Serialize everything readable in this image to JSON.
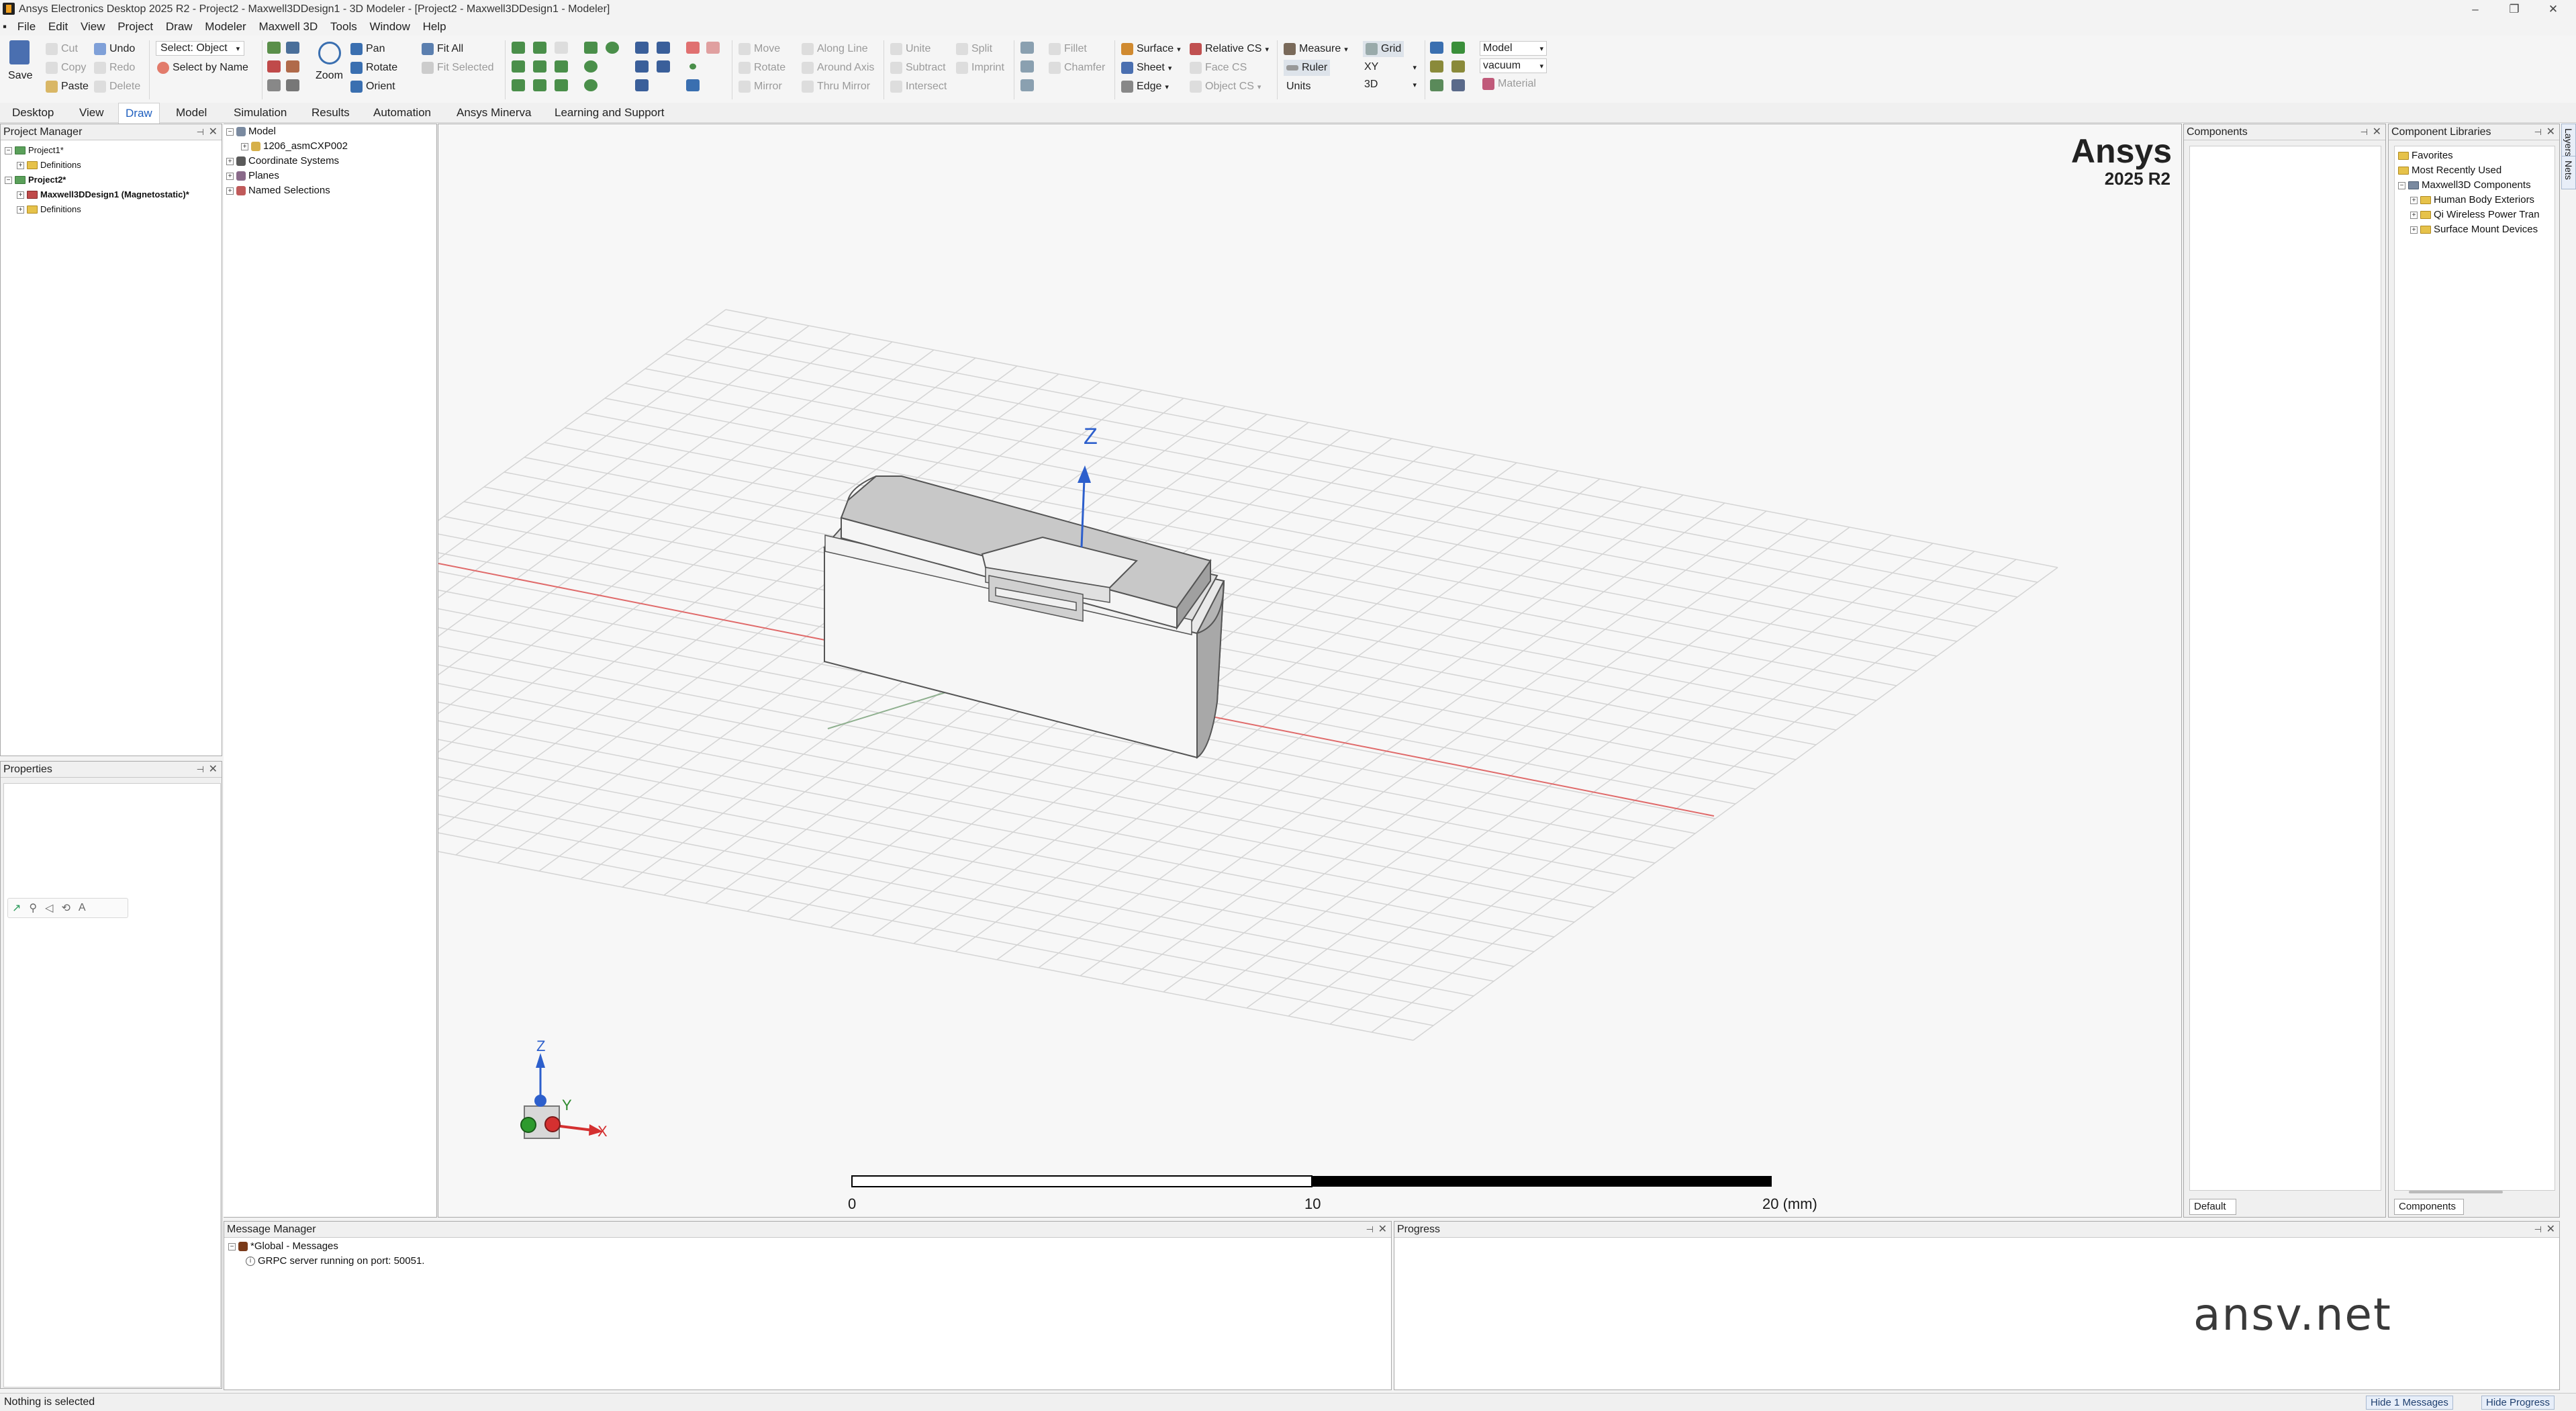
{
  "window": {
    "title": "Ansys Electronics Desktop 2025 R2 - Project2 - Maxwell3DDesign1 - 3D Modeler - [Project2 - Maxwell3DDesign1 - Modeler]"
  },
  "menu": [
    "File",
    "Edit",
    "View",
    "Project",
    "Draw",
    "Modeler",
    "Maxwell 3D",
    "Tools",
    "Window",
    "Help"
  ],
  "ribbon": {
    "save": "Save",
    "cut": "Cut",
    "copy": "Copy",
    "paste": "Paste",
    "undo": "Undo",
    "redo": "Redo",
    "delete": "Delete",
    "select_object": "Select: Object",
    "select_by_name": "Select by Name",
    "zoom": "Zoom",
    "pan": "Pan",
    "rotate": "Rotate",
    "orient": "Orient",
    "fit_all": "Fit All",
    "fit_selected": "Fit Selected",
    "move": "Move",
    "rotate2": "Rotate",
    "mirror": "Mirror",
    "along_line": "Along Line",
    "around_axis": "Around Axis",
    "thru_mirror": "Thru Mirror",
    "unite": "Unite",
    "subtract": "Subtract",
    "intersect": "Intersect",
    "split": "Split",
    "imprint": "Imprint",
    "fillet": "Fillet",
    "chamfer": "Chamfer",
    "surface": "Surface",
    "sheet": "Sheet",
    "edge": "Edge",
    "relative_cs": "Relative CS",
    "face_cs": "Face CS",
    "object_cs": "Object CS",
    "measure": "Measure",
    "ruler": "Ruler",
    "units": "Units",
    "grid": "Grid",
    "plane_value": "XY",
    "dim_value": "3D",
    "model_value": "Model",
    "material_value": "vacuum",
    "material": "Material"
  },
  "tabs": [
    "Desktop",
    "View",
    "Draw",
    "Model",
    "Simulation",
    "Results",
    "Automation",
    "Ansys Minerva",
    "Learning and Support"
  ],
  "active_tab": "Draw",
  "project_manager": {
    "title": "Project Manager",
    "items": [
      {
        "label": "Project1*"
      },
      {
        "label": "Definitions"
      },
      {
        "label": "Project2*"
      },
      {
        "label": "Maxwell3DDesign1 (Magnetostatic)*"
      },
      {
        "label": "Definitions"
      }
    ]
  },
  "properties": {
    "title": "Properties"
  },
  "model_tree": {
    "items": [
      {
        "label": "Model"
      },
      {
        "label": "1206_asmCXP002"
      },
      {
        "label": "Coordinate Systems"
      },
      {
        "label": "Planes"
      },
      {
        "label": "Named Selections"
      }
    ]
  },
  "viewport": {
    "brand": "Ansys",
    "version": "2025 R2",
    "z_label": "Z",
    "triad": {
      "z": "Z",
      "y": "Y",
      "x": "X"
    },
    "scale": {
      "t0": "0",
      "t1": "10",
      "t2": "20 (mm)"
    }
  },
  "components": {
    "title": "Components",
    "footer_tab": "Default"
  },
  "component_libraries": {
    "title": "Component Libraries",
    "items": [
      {
        "label": "Favorites"
      },
      {
        "label": "Most Recently Used"
      },
      {
        "label": "Maxwell3D Components"
      },
      {
        "label": "Human Body Exteriors"
      },
      {
        "label": "Qi Wireless Power Tran"
      },
      {
        "label": "Surface Mount Devices"
      }
    ],
    "footer_tab": "Components",
    "side_tabs": [
      "Layers",
      "Nets"
    ]
  },
  "message_manager": {
    "title": "Message Manager",
    "global": "*Global - Messages",
    "message": "GRPC server running on port: 50051."
  },
  "progress": {
    "title": "Progress"
  },
  "watermark": "ansv.net",
  "status": {
    "text": "Nothing is selected",
    "hide_messages": "Hide 1 Messages",
    "hide_progress": "Hide Progress"
  },
  "colors": {
    "accent": "#1f5fbf",
    "axis_z": "#2d5fcc",
    "x_axis_red": "#d44040",
    "y_axis_green": "#3a8f3a"
  }
}
